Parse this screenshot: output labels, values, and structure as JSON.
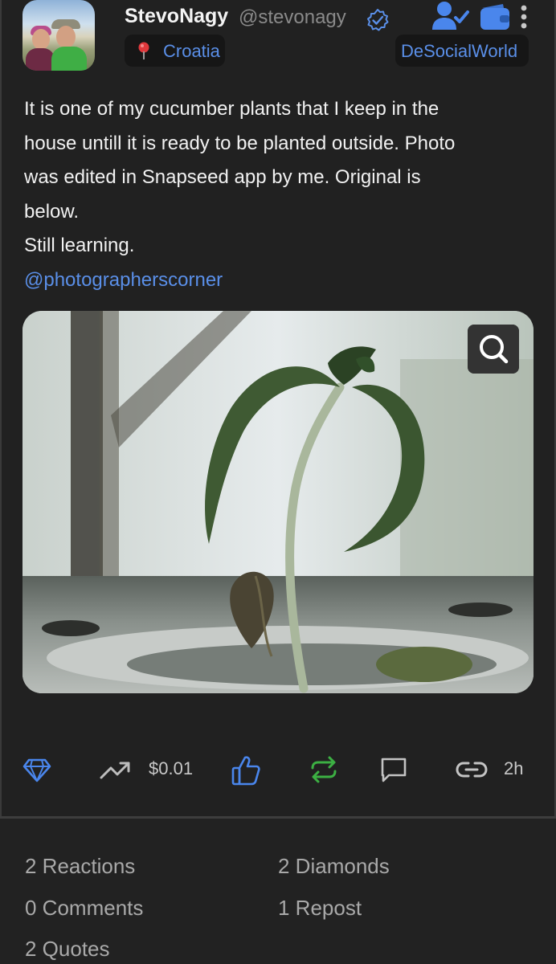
{
  "post": {
    "author": {
      "display_name": "StevoNagy",
      "handle": "@stevonagy",
      "verified_icon": "verified-check-icon",
      "avatar": "avatar-photo"
    },
    "location": {
      "icon": "pin-icon",
      "label": "Croatia"
    },
    "community": {
      "label": "DeSocialWorld"
    },
    "top_icons": [
      "follow-user-icon",
      "wallet-icon",
      "more-icon"
    ],
    "body_lines": [
      "It is one of my cucumber plants that I keep in the",
      "house untill it is ready to be planted outside. Photo",
      "was edited in Snapseed app by me. Original is",
      "below.",
      "Still learning."
    ],
    "mention": "@photographerscorner",
    "image": {
      "zoom_icon": "magnifier-icon"
    },
    "actions": {
      "diamond_icon": "diamond-icon",
      "trend_icon": "trending-up-icon",
      "value": "$0.01",
      "like_icon": "thumbs-up-icon",
      "repost_icon": "repost-icon",
      "comment_icon": "comment-icon",
      "link_icon": "link-icon",
      "time": "2h"
    }
  },
  "stats": {
    "reactions": "2 Reactions",
    "diamonds": "2 Diamonds",
    "comments": "0 Comments",
    "reposts": "1 Repost",
    "quotes": "2 Quotes"
  },
  "colors": {
    "background": "#212121",
    "accent_blue": "#5a8fe8",
    "repost_green": "#3cb043",
    "text_primary": "#f1f1f1",
    "text_muted": "#a9a9a9"
  }
}
